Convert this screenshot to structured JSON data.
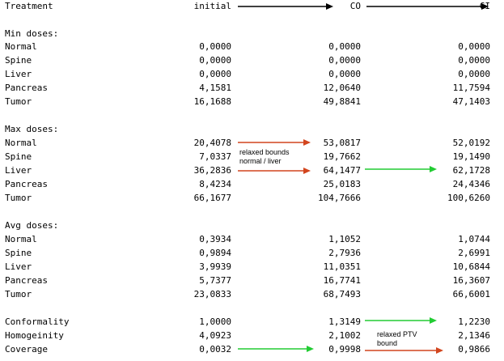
{
  "header": {
    "treatment": "Treatment",
    "initial": "initial",
    "co": "CO",
    "ci": "CI"
  },
  "sections": [
    {
      "title": "Min doses:",
      "rows": [
        {
          "label": "Normal",
          "initial": "0,0000",
          "co": "0,0000",
          "ci": "0,0000"
        },
        {
          "label": "Spine",
          "initial": "0,0000",
          "co": "0,0000",
          "ci": "0,0000"
        },
        {
          "label": "Liver",
          "initial": "0,0000",
          "co": "0,0000",
          "ci": "0,0000"
        },
        {
          "label": "Pancreas",
          "initial": "4,1581",
          "co": "12,0640",
          "ci": "11,7594"
        },
        {
          "label": "Tumor",
          "initial": "16,1688",
          "co": "49,8841",
          "ci": "47,1403"
        }
      ]
    },
    {
      "title": "Max doses:",
      "rows": [
        {
          "label": "Normal",
          "initial": "20,4078",
          "co": "53,0817",
          "ci": "52,0192"
        },
        {
          "label": "Spine",
          "initial": "7,0337",
          "co": "19,7662",
          "ci": "19,1490"
        },
        {
          "label": "Liver",
          "initial": "36,2836",
          "co": "64,1477",
          "ci": "62,1728"
        },
        {
          "label": "Pancreas",
          "initial": "8,4234",
          "co": "25,0183",
          "ci": "24,4346"
        },
        {
          "label": "Tumor",
          "initial": "66,1677",
          "co": "104,7666",
          "ci": "100,6260"
        }
      ]
    },
    {
      "title": "Avg doses:",
      "rows": [
        {
          "label": "Normal",
          "initial": "0,3934",
          "co": "1,1052",
          "ci": "1,0744"
        },
        {
          "label": "Spine",
          "initial": "0,9894",
          "co": "2,7936",
          "ci": "2,6991"
        },
        {
          "label": "Liver",
          "initial": "3,9939",
          "co": "11,0351",
          "ci": "10,6844"
        },
        {
          "label": "Pancreas",
          "initial": "5,7377",
          "co": "16,7741",
          "ci": "16,3607"
        },
        {
          "label": "Tumor",
          "initial": "23,0833",
          "co": "68,7493",
          "ci": "66,6001"
        }
      ]
    },
    {
      "title": "",
      "rows": [
        {
          "label": "Conformality",
          "initial": "1,0000",
          "co": "1,3149",
          "ci": "1,2230"
        },
        {
          "label": "Homogeinity",
          "initial": "4,0923",
          "co": "2,1002",
          "ci": "2,1346"
        },
        {
          "label": "Coverage",
          "initial": "0,0032",
          "co": "0,9998",
          "ci": "0,9866"
        }
      ]
    }
  ],
  "annotations": {
    "relaxed_bounds": "relaxed bounds\nnormal / liver",
    "relaxed_ptv": "relaxed PTV\nbound"
  },
  "colors": {
    "red_arrow": "#d2451e",
    "green_arrow": "#22cc33",
    "black_arrow": "#000000"
  }
}
